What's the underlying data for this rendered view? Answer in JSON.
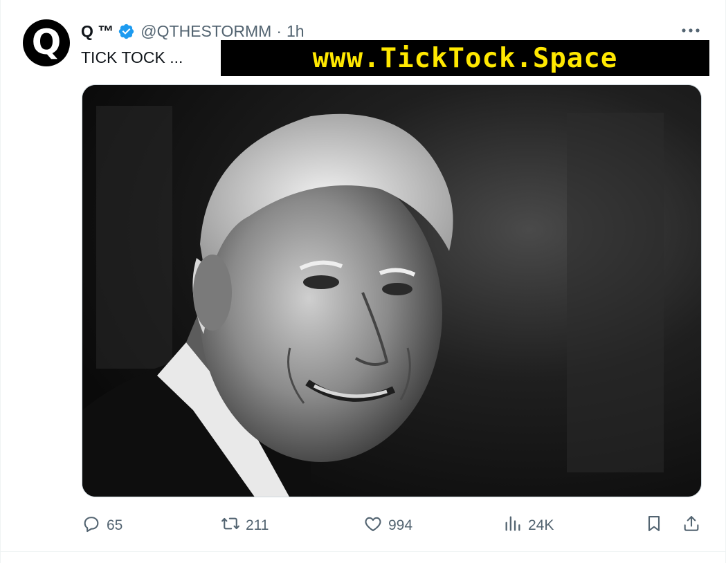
{
  "author": {
    "avatar_letter": "Q",
    "display_name": "Q ™",
    "handle": "@QTHESTORMM",
    "separator": "·",
    "time": "1h"
  },
  "tweet": {
    "text": "TICK TOCK ...",
    "overlay_text": "www.TickTock.Space",
    "image_icon": "portrait-photo"
  },
  "icons": {
    "verified": "verified-badge-icon",
    "more": "more-icon"
  },
  "stats": {
    "replies": "65",
    "retweets": "211",
    "likes": "994",
    "views": "24K"
  },
  "colors": {
    "verified_blue": "#1d9bf0",
    "muted_text": "#536471",
    "overlay_yellow": "#ffe800"
  }
}
